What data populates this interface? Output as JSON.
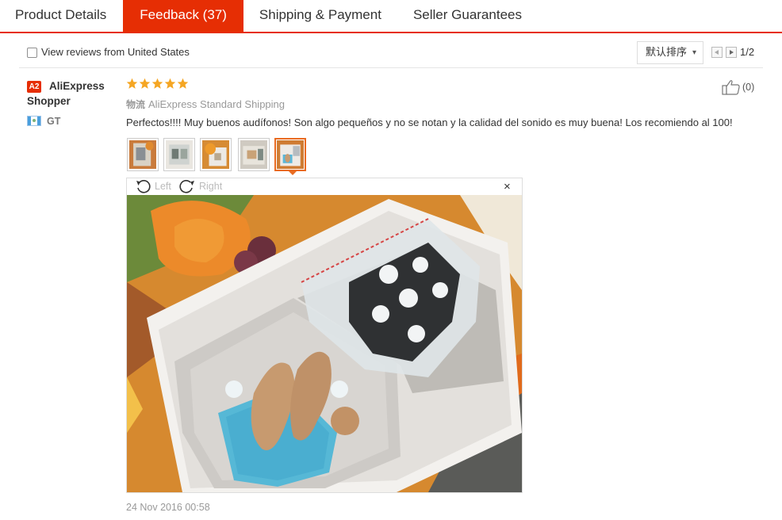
{
  "tabs": [
    {
      "label": "Product Details",
      "active": false
    },
    {
      "label": "Feedback (37)",
      "active": true
    },
    {
      "label": "Shipping & Payment",
      "active": false
    },
    {
      "label": "Seller Guarantees",
      "active": false
    }
  ],
  "filter": {
    "us_only_label": "View reviews from United States",
    "us_only_checked": false,
    "sort_selected": "默认排序",
    "pagination": "1/2"
  },
  "review": {
    "badge": "A2",
    "reviewer_name": "AliExpress Shopper",
    "country_code": "GT",
    "rating": 5,
    "shipping_prefix": "物流",
    "shipping_method": "AliExpress Standard Shipping",
    "text": "Perfectos!!!! Muy buenos audífonos! Son algo pequeños y no se notan y la calidad del sonido es muy buena! Los recomiendo al 100!",
    "like_count": "(0)",
    "thumbnail_count": 5,
    "selected_thumbnail": 5,
    "date": "24 Nov 2016 00:58"
  },
  "viewer": {
    "rotate_left_label": "Left",
    "rotate_right_label": "Right",
    "close_label": "×"
  },
  "colors": {
    "accent": "#e62e04",
    "star": "#f5a623",
    "thumb_selected": "#e96b21"
  },
  "icons": [
    "checkbox-icon",
    "chevron-down-icon",
    "page-prev-icon",
    "page-next-icon",
    "star-icon",
    "thumbs-up-icon",
    "rotate-left-icon",
    "rotate-right-icon",
    "close-icon",
    "flag-icon"
  ]
}
